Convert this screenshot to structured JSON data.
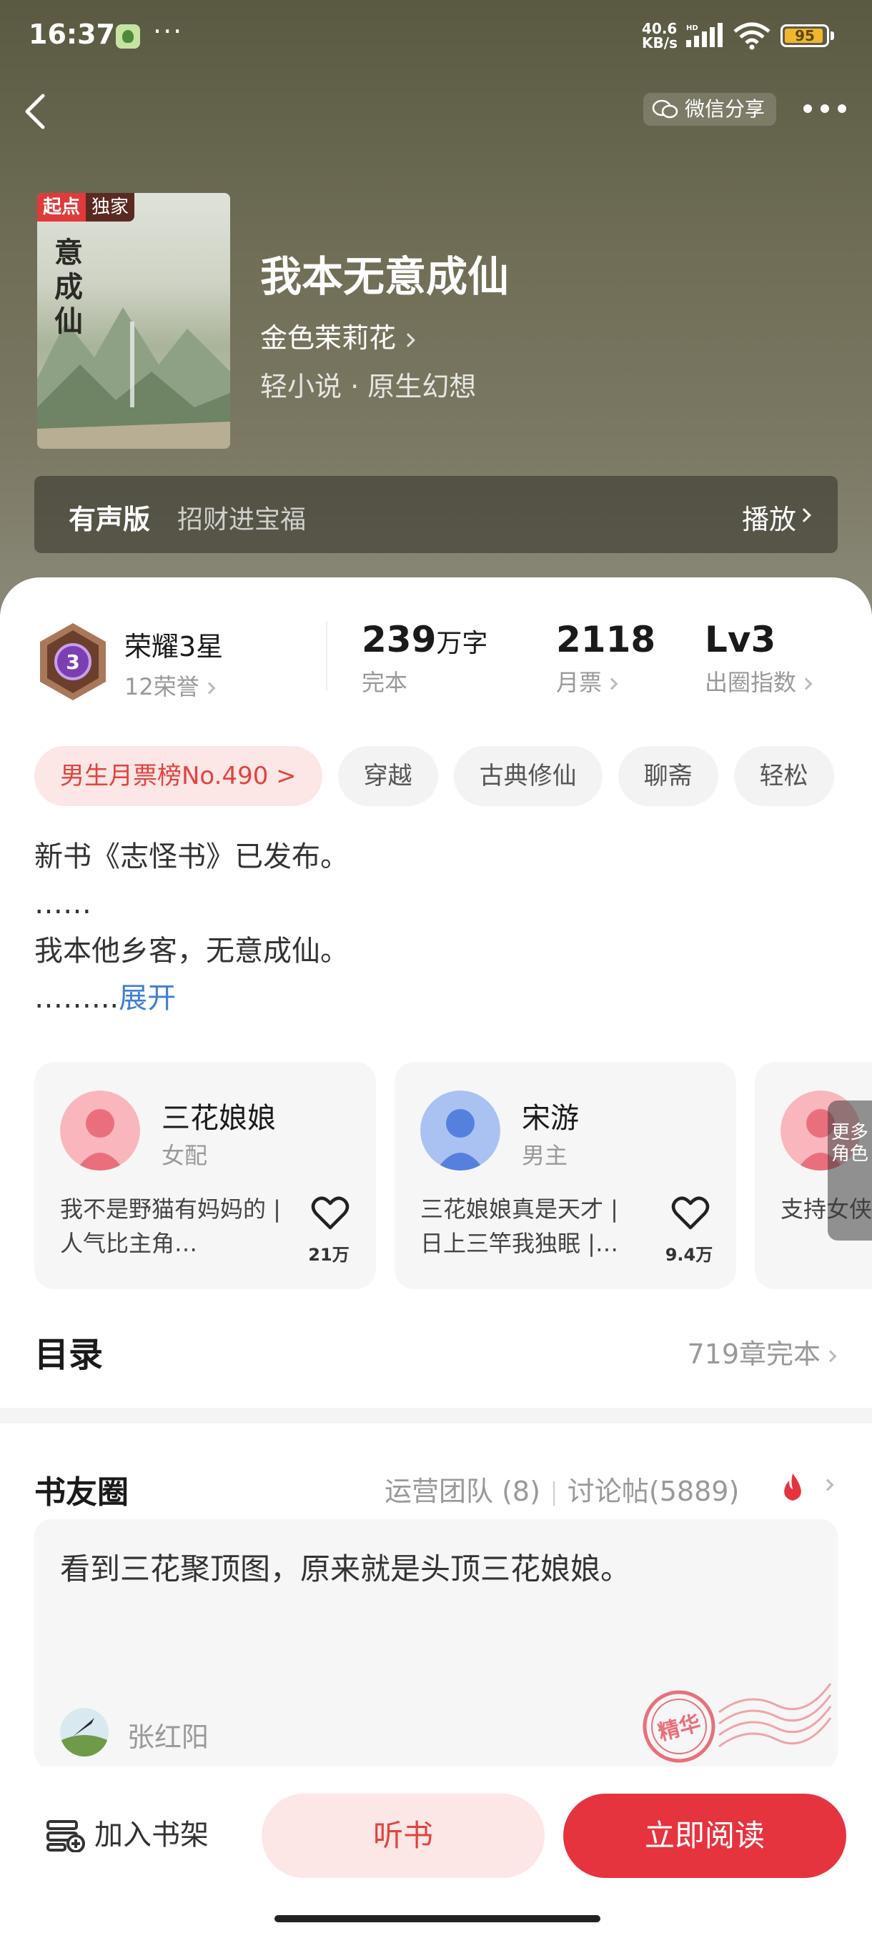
{
  "status_bar": {
    "time": "16:37",
    "dots": "···",
    "net_speed": "40.6",
    "net_unit": "KB/s",
    "hd": "HD",
    "battery": "95",
    "battery_level": 0.95
  },
  "nav": {
    "share_label": "微信分享"
  },
  "book": {
    "cover_tag_1": "起点",
    "cover_tag_2": "独家",
    "cover_title_vertical": "意成仙",
    "title": "我本无意成仙",
    "author": "金色茉莉花",
    "genre": "轻小说 · 原生幻想"
  },
  "audio": {
    "label": "有声版",
    "narrator": "招财进宝福",
    "play_label": "播放"
  },
  "stats": {
    "honor_title": "荣耀3星",
    "honor_sub": "12荣誉",
    "honor_level": "3",
    "words_value": "239",
    "words_unit": "万字",
    "words_sub": "完本",
    "tickets_value": "2118",
    "tickets_sub": "月票",
    "index_value": "Lv3",
    "index_sub": "出圈指数"
  },
  "tags": [
    "男生月票榜No.490 >",
    "穿越",
    "古典修仙",
    "聊斋",
    "轻松"
  ],
  "intro": {
    "line1": "新书《志怪书》已发布。",
    "line2": "……",
    "line3": "我本他乡客，无意成仙。",
    "line4": "……...",
    "expand": "展开"
  },
  "characters": [
    {
      "name": "三花娘娘",
      "role": "女配",
      "desc": "我不是野猫有妈妈的 | 人气比主角…",
      "likes": "21万"
    },
    {
      "name": "宋游",
      "role": "男主",
      "desc": "三花娘娘真是天才 | 日上三竿我独眠 |…",
      "likes": "9.4万"
    },
    {
      "name": "",
      "role": "",
      "desc": "支持女侠 | 厉害啊道",
      "likes": ""
    }
  ],
  "more_roles": "更多角色",
  "toc": {
    "title": "目录",
    "info": "719章完本"
  },
  "circle": {
    "title": "书友圈",
    "team": "运营团队 (8)",
    "posts": "讨论帖(5889)"
  },
  "post": {
    "text": "看到三花聚顶图，原来就是头顶三花娘娘。",
    "user": "张红阳",
    "stamp": "精华"
  },
  "bottom": {
    "shelf": "加入书架",
    "listen": "听书",
    "read": "立即阅读"
  }
}
